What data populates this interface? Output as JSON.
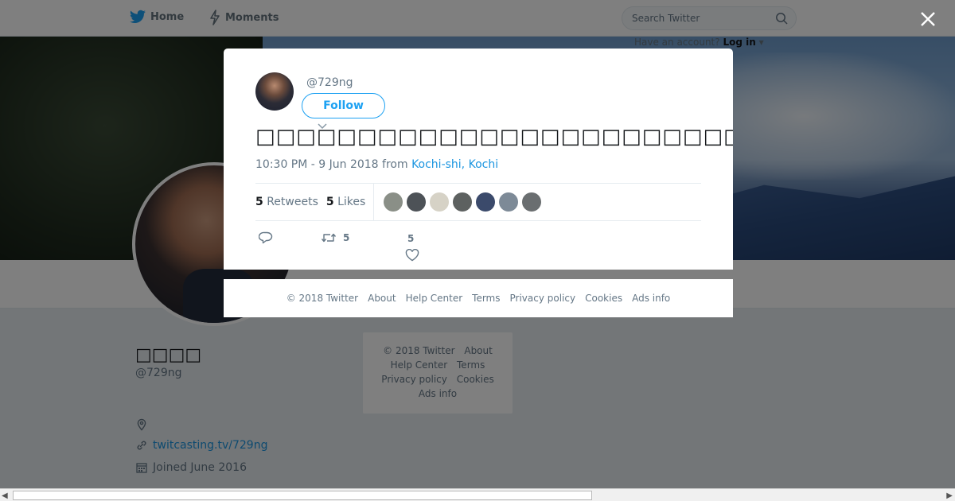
{
  "nav": {
    "home_label": "Home",
    "moments_label": "Moments",
    "search_placeholder": "Search Twitter",
    "login_prompt": "Have an account?",
    "login_label": "Log in"
  },
  "profile": {
    "display_name": "□□□□",
    "handle": "@729ng",
    "link": "twitcasting.tv/729ng",
    "joined": "Joined June 2016"
  },
  "sidebar_footer": {
    "items": [
      "© 2018 Twitter",
      "About",
      "Help Center",
      "Terms",
      "Privacy policy",
      "Cookies",
      "Ads info"
    ]
  },
  "tweet": {
    "handle": "@729ng",
    "follow_label": "Follow",
    "text": "□□□□□□□□□□□□□□□□□□□□□□□□□□□□□□□□□□□□□□□□□□□□□□□□□□□□□",
    "time": "10:30 PM - 9 Jun 2018 from ",
    "place": "Kochi-shi, Kochi",
    "retweets_count": "5",
    "retweets_label": "Retweets",
    "likes_count": "5",
    "likes_label": "Likes",
    "retweet_action_count": "5",
    "like_action_count": "5",
    "liker_colors": [
      "#8a8f87",
      "#4d5257",
      "#d6d2c6",
      "#5d6160",
      "#3b4a6b",
      "#7d8a97",
      "#6a6e70"
    ]
  },
  "modal_footer": {
    "items": [
      "© 2018 Twitter",
      "About",
      "Help Center",
      "Terms",
      "Privacy policy",
      "Cookies",
      "Ads info"
    ]
  },
  "colors": {
    "accent": "#1da1f2",
    "link": "#1b95e0"
  }
}
